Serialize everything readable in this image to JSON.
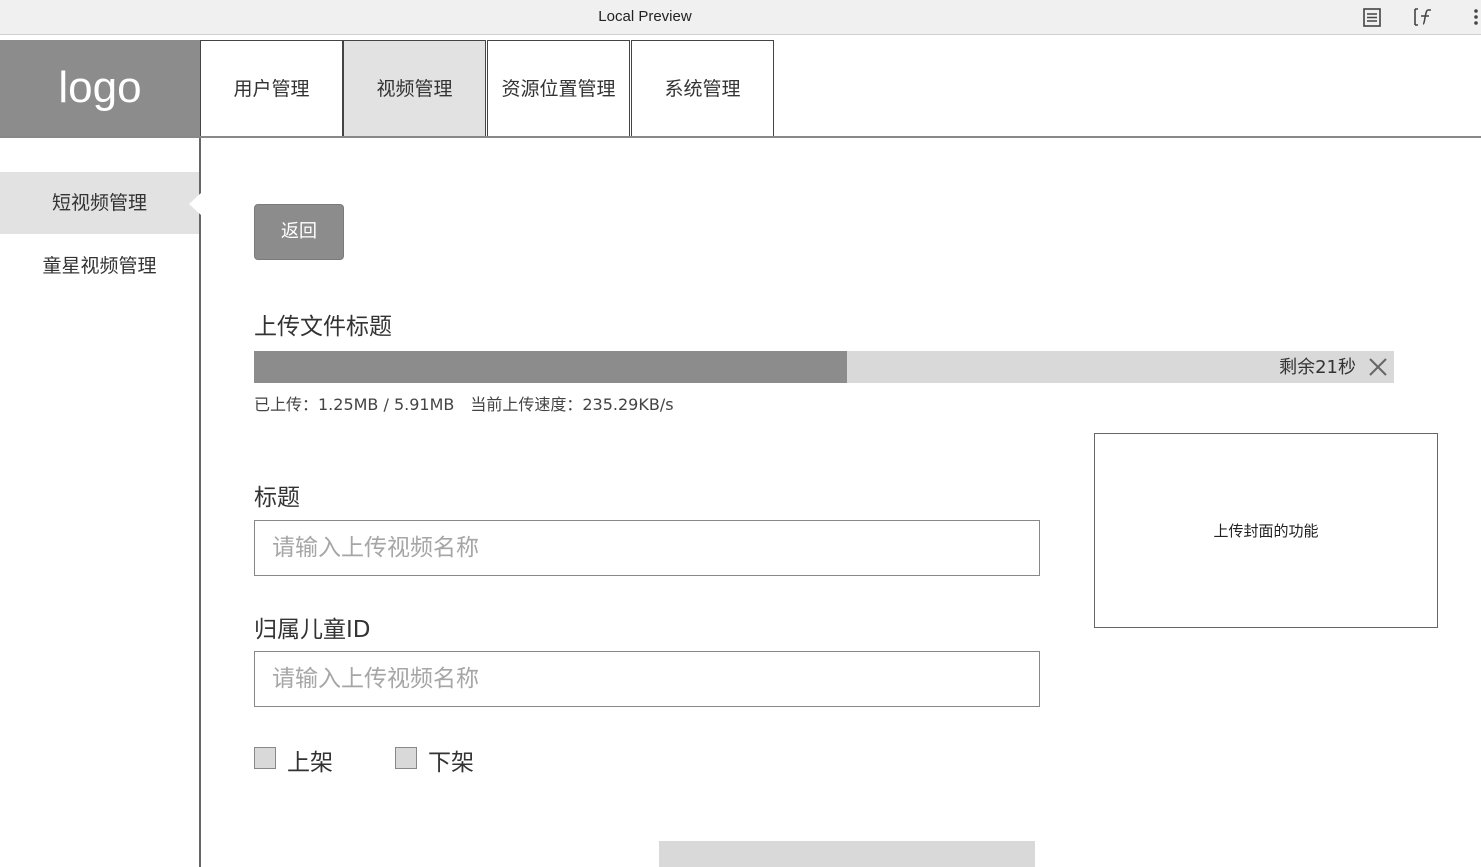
{
  "window": {
    "title": "Local Preview",
    "icons": [
      "list-icon",
      "function-icon",
      "more-icon"
    ]
  },
  "header": {
    "logo": "logo",
    "tabs": [
      {
        "label": "用户管理",
        "active": false
      },
      {
        "label": "视频管理",
        "active": true
      },
      {
        "label": "资源位置管理",
        "active": false
      },
      {
        "label": "系统管理",
        "active": false
      }
    ]
  },
  "sidebar": {
    "items": [
      {
        "label": "短视频管理",
        "active": true
      },
      {
        "label": "童星视频管理",
        "active": false
      }
    ]
  },
  "main": {
    "back_button": "返回",
    "upload": {
      "title": "上传文件标题",
      "progress_fraction": 0.52,
      "remaining": "剩余21秒",
      "stats": "已上传：1.25MB / 5.91MB　当前上传速度：235.29KB/s"
    },
    "title_field": {
      "label": "标题",
      "placeholder": "请输入上传视频名称"
    },
    "child_id_field": {
      "label": "归属儿童ID",
      "placeholder": "请输入上传视频名称"
    },
    "cover_upload": "上传封面的功能",
    "status_options": [
      "上架",
      "下架"
    ]
  },
  "colors": {
    "dark_gray": "#8c8c8c",
    "light_gray": "#d9d9d9",
    "active_bg": "#e2e2e2"
  }
}
